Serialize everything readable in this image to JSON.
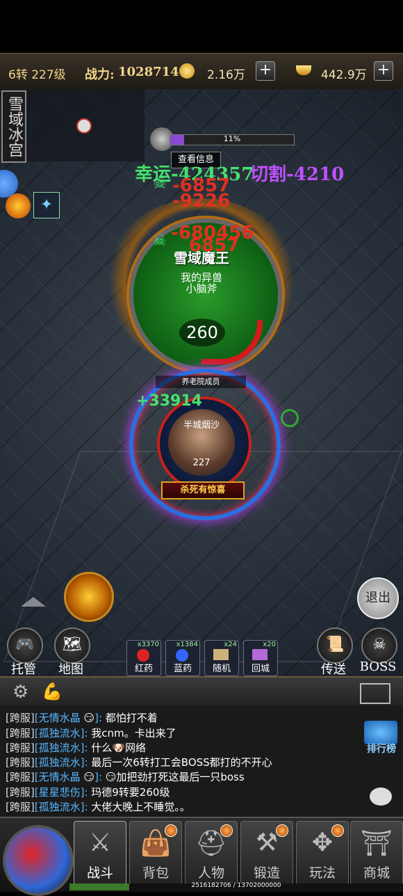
{
  "topbar": {
    "level": "6转 227级",
    "power_label": "战力:",
    "power_value": "1028714",
    "currency1": "2.16万",
    "currency2": "442.9万",
    "plus": "+"
  },
  "map": {
    "name": "雪域冰宫"
  },
  "boss_bar": {
    "percent_text": "11%",
    "fill_fraction": 0.11,
    "info_button": "查看信息"
  },
  "damage_texts": {
    "luck": "幸运-424357",
    "cut": "切割-4210",
    "d1": "-6857",
    "d2": "-9226",
    "d3": "-680456",
    "d4": "6857",
    "heal": "+33914"
  },
  "boss": {
    "name": "雪域魔王",
    "pet_line1": "我的异兽",
    "pet_line2": "小脑斧",
    "hp_number": "260"
  },
  "player": {
    "title_tag": "养老院成员",
    "name": "半城烟沙",
    "level": "227",
    "banner": "杀死有惊喜"
  },
  "buttons": {
    "exit": "退出",
    "auto": "托管",
    "map": "地图",
    "teleport": "传送",
    "boss": "BOSS",
    "ranking": "排行榜"
  },
  "potions": [
    {
      "count": "x3370",
      "label": "红药"
    },
    {
      "count": "x1384",
      "label": "蓝药"
    },
    {
      "count": "x24",
      "label": "随机"
    },
    {
      "count": "x20",
      "label": "回城"
    }
  ],
  "chat": [
    {
      "server": "[跨服]",
      "name": "[无情水晶",
      "emoji": "😏",
      "suffix": "]: ",
      "text": "都怕打不着"
    },
    {
      "server": "[跨服]",
      "name": "[孤独流水]",
      "emoji": "",
      "suffix": ": ",
      "text": "我cnm。卡出来了"
    },
    {
      "server": "[跨服]",
      "name": "[孤独流水]",
      "emoji": "",
      "suffix": ": ",
      "text": "什么🐶网络"
    },
    {
      "server": "[跨服]",
      "name": "[孤独流水]",
      "emoji": "",
      "suffix": ": ",
      "text": "最后一次6转打工会BOSS都打的不开心"
    },
    {
      "server": "[跨服]",
      "name": "[无情水晶",
      "emoji": "😏",
      "suffix": "]:  ",
      "text": "😏加把劲打死这最后一只boss"
    },
    {
      "server": "[跨服]",
      "name": "[星星悲伤]",
      "emoji": "",
      "suffix": ": ",
      "text": "玛德9转要260级"
    },
    {
      "server": "[跨服]",
      "name": "[孤独流水]",
      "emoji": "",
      "suffix": ": ",
      "text": "大佬大晚上不睡觉。。"
    }
  ],
  "nav": [
    {
      "label": "战斗"
    },
    {
      "label": "背包"
    },
    {
      "label": "人物"
    },
    {
      "label": "锻造"
    },
    {
      "label": "玩法"
    },
    {
      "label": "商城"
    }
  ],
  "exp": {
    "text": "2516182706 / 13702000000",
    "fraction": 0.18
  },
  "colors": {
    "gold": "#f2d58a",
    "damage_red": "#e03020",
    "damage_green": "#46e070",
    "purple": "#c050ff",
    "chat_name": "#59b8ff"
  }
}
